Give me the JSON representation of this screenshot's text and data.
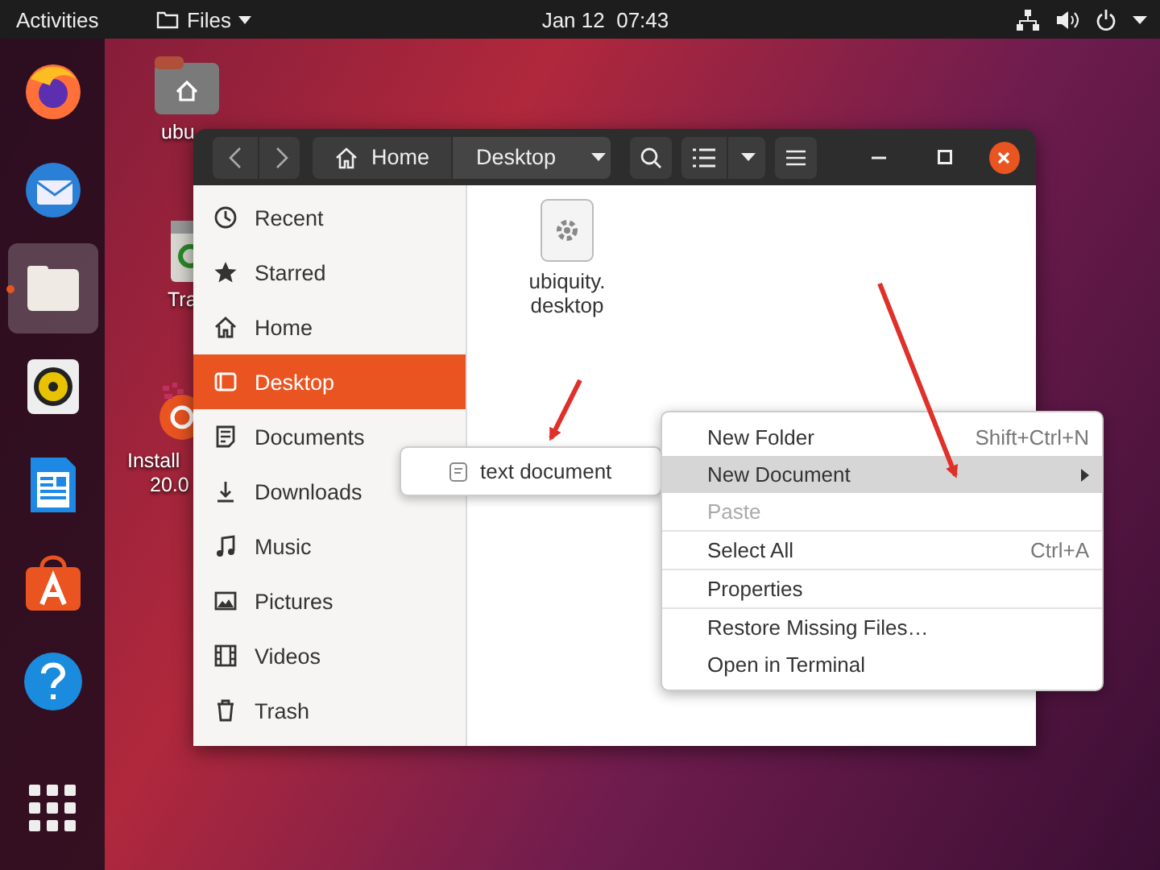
{
  "top_bar": {
    "activities": "Activities",
    "app_menu": "Files",
    "clock": "Jan 12  07:43"
  },
  "dock": {
    "items": [
      {
        "kind": "browser",
        "selected": false
      },
      {
        "kind": "mail",
        "selected": false
      },
      {
        "kind": "files",
        "selected": true
      },
      {
        "kind": "speaker",
        "selected": false
      },
      {
        "kind": "writer",
        "selected": false
      },
      {
        "kind": "store",
        "selected": false
      },
      {
        "kind": "help",
        "selected": false
      }
    ]
  },
  "desktop_icons": [
    {
      "kind": "home-folder",
      "lines": [
        "ubu"
      ]
    },
    {
      "kind": "trash",
      "lines": [
        "Tra"
      ]
    },
    {
      "kind": "installer",
      "lines": [
        "Install",
        "20.0"
      ]
    }
  ],
  "window": {
    "path": [
      {
        "kind": "home",
        "label": "Home",
        "selected": false
      },
      {
        "kind": "folder",
        "label": "Desktop",
        "selected": true
      }
    ],
    "sidebar": {
      "items": [
        {
          "kind": "recent",
          "label": "Recent",
          "selected": false
        },
        {
          "kind": "star",
          "label": "Starred",
          "selected": false
        },
        {
          "kind": "home",
          "label": "Home",
          "selected": false
        },
        {
          "kind": "desktop",
          "label": "Desktop",
          "selected": true
        },
        {
          "kind": "documents",
          "label": "Documents",
          "selected": false
        },
        {
          "kind": "downloads",
          "label": "Downloads",
          "selected": false
        },
        {
          "kind": "music",
          "label": "Music",
          "selected": false
        },
        {
          "kind": "pictures",
          "label": "Pictures",
          "selected": false
        },
        {
          "kind": "videos",
          "label": "Videos",
          "selected": false
        },
        {
          "kind": "trash",
          "label": "Trash",
          "selected": false
        }
      ]
    },
    "files": [
      {
        "name_lines": [
          "ubiquity.",
          "desktop"
        ]
      }
    ]
  },
  "context_menu": {
    "items": [
      {
        "kind": "item",
        "label": "New Folder",
        "shortcut": "Shift+Ctrl+N",
        "selected": false,
        "disabled": false
      },
      {
        "kind": "submenu",
        "label": "New Document",
        "selected": true,
        "disabled": false
      },
      {
        "kind": "item",
        "label": "Paste",
        "selected": false,
        "disabled": true
      },
      {
        "kind": "separator"
      },
      {
        "kind": "item",
        "label": "Select All",
        "shortcut": "Ctrl+A",
        "selected": false,
        "disabled": false
      },
      {
        "kind": "separator"
      },
      {
        "kind": "item",
        "label": "Properties",
        "selected": false,
        "disabled": false
      },
      {
        "kind": "separator"
      },
      {
        "kind": "item",
        "label": "Restore Missing Files…",
        "selected": false,
        "disabled": false
      },
      {
        "kind": "item",
        "label": "Open in Terminal",
        "selected": false,
        "disabled": false
      }
    ]
  },
  "submenu": {
    "items": [
      {
        "label": "text document"
      }
    ]
  }
}
